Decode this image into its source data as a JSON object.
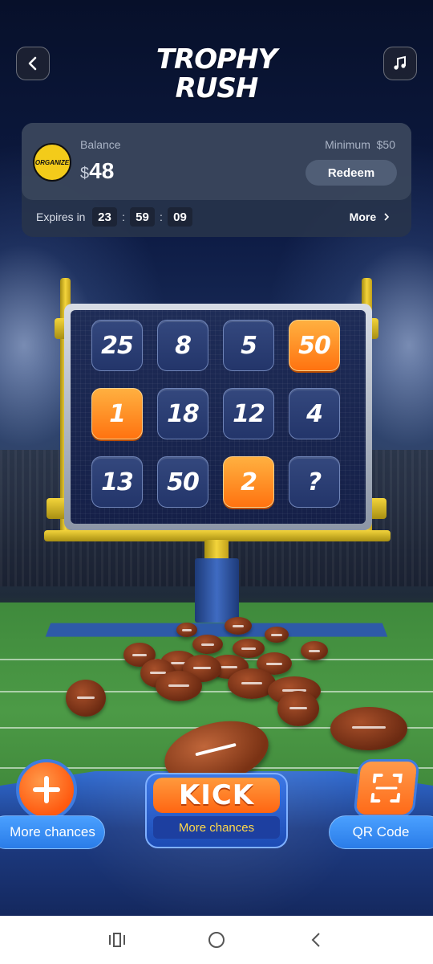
{
  "header": {
    "title_line1": "TROPHY",
    "title_line2": "RUSH",
    "back_icon": "chevron-left-icon",
    "music_icon": "music-note-icon"
  },
  "balance_card": {
    "logo_text": "ORGANIZE",
    "label": "Balance",
    "currency": "$",
    "amount": "48",
    "minimum_label": "Minimum",
    "minimum_value": "$50",
    "redeem_label": "Redeem",
    "expires_label": "Expires in",
    "timer": {
      "hours": "23",
      "minutes": "59",
      "seconds": "09",
      "separator": ":"
    },
    "more_label": "More",
    "more_icon": "chevron-right-icon"
  },
  "board": {
    "tiles": [
      {
        "value": "25",
        "color": "blue"
      },
      {
        "value": "8",
        "color": "blue"
      },
      {
        "value": "5",
        "color": "blue"
      },
      {
        "value": "50",
        "color": "orange"
      },
      {
        "value": "1",
        "color": "orange"
      },
      {
        "value": "18",
        "color": "blue"
      },
      {
        "value": "12",
        "color": "blue"
      },
      {
        "value": "4",
        "color": "blue"
      },
      {
        "value": "13",
        "color": "blue"
      },
      {
        "value": "50",
        "color": "blue"
      },
      {
        "value": "2",
        "color": "orange"
      },
      {
        "value": "?",
        "color": "blue"
      }
    ]
  },
  "controls": {
    "more_chances_left": "More chances",
    "kick_label": "KICK",
    "kick_sub": "More chances",
    "qr_label": "QR Code",
    "plus_icon": "plus-icon",
    "qr_icon": "qr-scan-icon"
  },
  "system_nav": {
    "recents_icon": "recents-icon",
    "home_icon": "home-circle-icon",
    "back_icon": "back-chevron-icon"
  },
  "colors": {
    "orange_tile": "#ff7310",
    "blue_tile": "#23356a",
    "button_blue": "#2a7ce8",
    "kick_sub_text": "#ffd84a"
  }
}
